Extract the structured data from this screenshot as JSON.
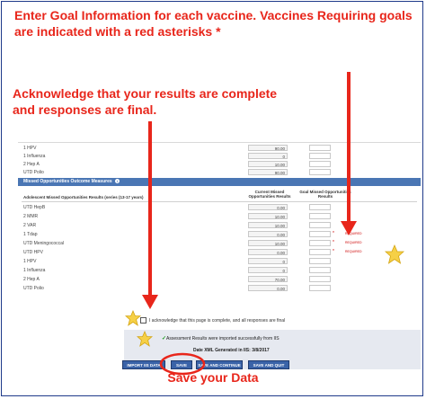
{
  "annotations": {
    "top": "Enter Goal Information for each vaccine.  Vaccines Requiring goals are indicated with a red asterisks *",
    "middle": "Acknowledge that your results are complete and responses are final.",
    "bottom": "Save your Data"
  },
  "upper_rows": [
    {
      "label": "1 HPV",
      "current": "90.00"
    },
    {
      "label": "1 Influenza",
      "current": "0"
    },
    {
      "label": "2 Hep A",
      "current": "10.00"
    },
    {
      "label": "UTD Polio",
      "current": "90.00"
    }
  ],
  "section": {
    "title": "Missed Opportunities Outcome Measures",
    "column_series": "Adolescent Missed Opportunities Results (series (13-17 years)",
    "column_current": "Current Missed Opportunities Results",
    "column_goal": "Goal Missed Opportunities Results"
  },
  "missed_rows": [
    {
      "label": "UTD HepB",
      "current": "0.00",
      "required": false
    },
    {
      "label": "2 MMR",
      "current": "10.00",
      "required": false
    },
    {
      "label": "2 VAR",
      "current": "10.00",
      "required": false
    },
    {
      "label": "1 Tdap",
      "current": "0.00",
      "required": true
    },
    {
      "label": "UTD Meningococcal",
      "current": "10.00",
      "required": true
    },
    {
      "label": "UTD HPV",
      "current": "0.00",
      "required": true
    },
    {
      "label": "1 HPV",
      "current": "0",
      "required": false
    },
    {
      "label": "1 Influenza",
      "current": "0",
      "required": false
    },
    {
      "label": "2 Hep A",
      "current": "70.00",
      "required": false
    },
    {
      "label": "UTD Polio",
      "current": "0.00",
      "required": false
    }
  ],
  "required_text": "REQUIRED",
  "asterisk": "*",
  "acknowledge_text": "I acknowledge that this page is complete, and all responses are final",
  "imported_text": "Assessment Results were imported successfully from IIS",
  "date_text": "Date XML Generated in IIS: 3/8/2017",
  "buttons": {
    "import": "IMPORT IIS DATA",
    "save": "SAVE",
    "save_continue": "SAVE AND CONTINUE",
    "save_quit": "SAVE AND QUIT"
  },
  "colors": {
    "annotation_red": "#e8261b",
    "button_blue": "#3a63a8",
    "section_blue": "#4a76b4",
    "star_yellow": "#f6d046"
  }
}
